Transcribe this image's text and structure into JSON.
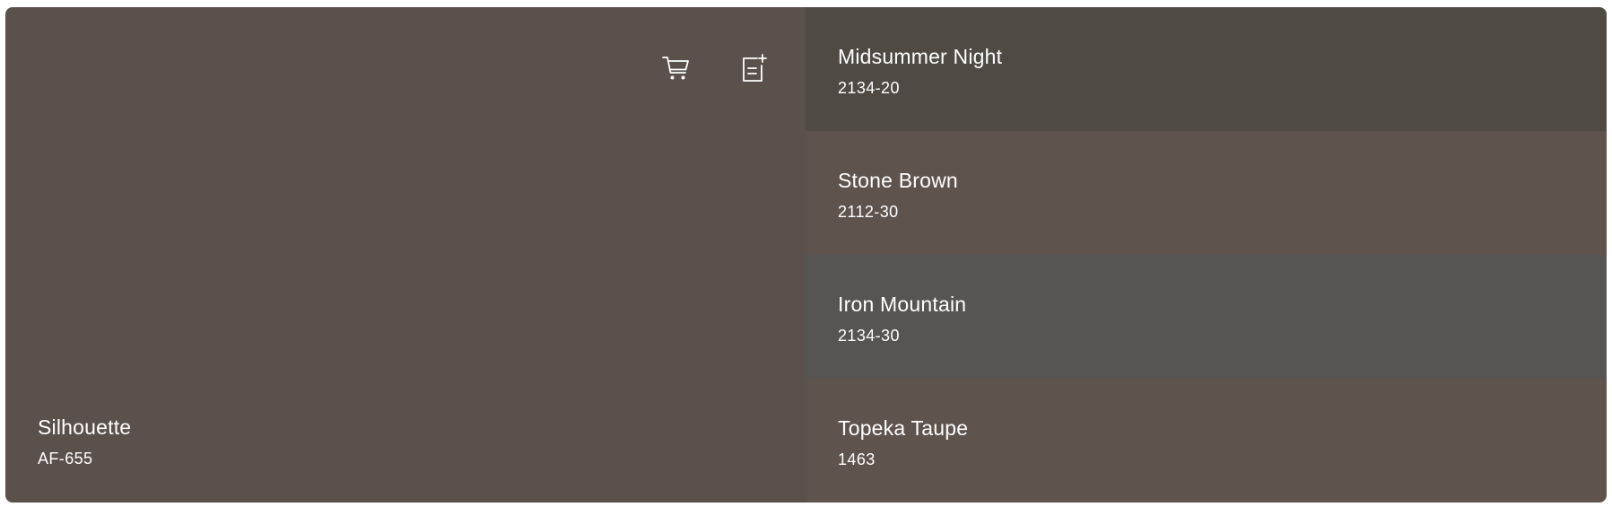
{
  "main": {
    "name": "Silhouette",
    "code": "AF-655",
    "color": "#5a504c"
  },
  "actions": {
    "cart_icon": "shopping-cart-icon",
    "add_list_icon": "add-to-list-icon"
  },
  "related": [
    {
      "name": "Midsummer Night",
      "code": "2134-20",
      "color": "#504a45"
    },
    {
      "name": "Stone Brown",
      "code": "2112-30",
      "color": "#5f534e"
    },
    {
      "name": "Iron Mountain",
      "code": "2134-30",
      "color": "#575553"
    },
    {
      "name": "Topeka Taupe",
      "code": "1463",
      "color": "#5f534e"
    }
  ]
}
